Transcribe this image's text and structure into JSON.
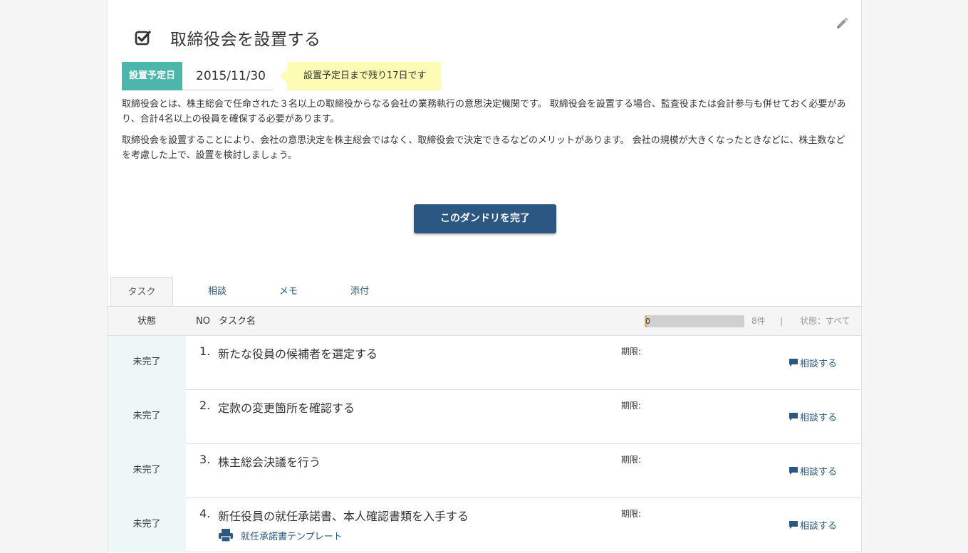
{
  "header": {
    "title": "取締役会を設置する",
    "date_label": "設置予定日",
    "date_value": "2015/11/30",
    "date_tip": "設置予定日まで残り17日です"
  },
  "description": [
    "取締役会とは、株主総会で任命された３名以上の取締役からなる会社の業務執行の意思決定機関です。 取締役会を設置する場合、監査役または会計参与も併せておく必要があり、合計4名以上の役員を確保する必要があります。",
    "取締役会を設置することにより、会社の意思決定を株主総会ではなく、取締役会で決定できるなどのメリットがあります。 会社の規模が大きくなったときなどに、株主数などを考慮した上で、設置を検討しましょう。"
  ],
  "complete_button": "このダンドリを完了",
  "tabs": [
    {
      "label": "タスク",
      "active": true
    },
    {
      "label": "相談",
      "active": false
    },
    {
      "label": "メモ",
      "active": false
    },
    {
      "label": "添付",
      "active": false
    }
  ],
  "table": {
    "col_status": "状態",
    "col_no": "NO",
    "col_name": "タスク名",
    "progress_value": 0,
    "progress_label": "0",
    "count": "8件",
    "separator": "|",
    "filter": "状態：すべて"
  },
  "tasks": [
    {
      "status": "未完了",
      "no": "1.",
      "name": "新たな役員の候補者を選定する",
      "deadline": "期限:",
      "consult": "相談する"
    },
    {
      "status": "未完了",
      "no": "2.",
      "name": "定款の変更箇所を確認する",
      "deadline": "期限:",
      "consult": "相談する"
    },
    {
      "status": "未完了",
      "no": "3.",
      "name": "株主総会決議を行う",
      "deadline": "期限:",
      "consult": "相談する"
    },
    {
      "status": "未完了",
      "no": "4.",
      "name": "新任役員の就任承諾書、本人確認書類を入手する",
      "deadline": "期限:",
      "consult": "相談する",
      "attachment": "就任承諾書テンプレート"
    }
  ],
  "colors": {
    "accent": "#2b5782",
    "label_teal": "#4db6ac",
    "tip_yellow": "#fcfcb4",
    "status_bg": "#edf7f6",
    "progress": "#f0ad4e"
  },
  "icons": {
    "title": "check-square-icon",
    "edit": "pencil-icon",
    "consult": "speech-bubble-icon",
    "attachment": "printer-icon"
  }
}
